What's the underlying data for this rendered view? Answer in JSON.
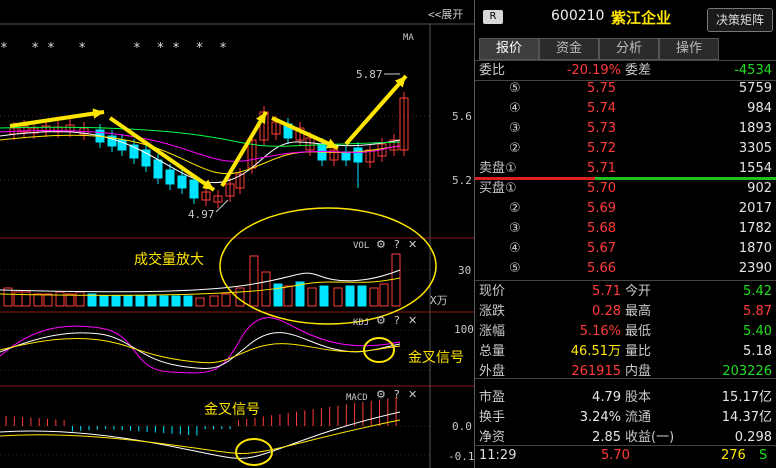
{
  "chart": {
    "expand_label": "<<展开",
    "ma_label": "MA",
    "vol_label": "VOL",
    "kdj_label": "KDJ",
    "macd_label": "MACD",
    "settings_icon": "gear-icon",
    "help_icon": "question-icon",
    "close_icon": "close-icon",
    "high_label": "5.87",
    "low_label": "4.97",
    "price_axis": [
      "5.6",
      "5.2"
    ],
    "vol_axis": [
      "30"
    ],
    "vol_unit": "X万",
    "kdj_axis": [
      "100",
      "50",
      "0"
    ],
    "macd_axis": [
      "0.0",
      "-0.1"
    ],
    "stars": "*   * *   *      *  * *  *  *",
    "annotation_volume": "成交量放大",
    "annotation_golden_cross_kdj": "金叉信号",
    "annotation_golden_cross_macd": "金叉信号"
  },
  "header": {
    "badge": "R",
    "code": "600210",
    "name": "紫江企业",
    "decision_button": "决策矩阵"
  },
  "tabs": [
    "报价",
    "资金",
    "分析",
    "操作"
  ],
  "commission": {
    "ratio_label": "委比",
    "ratio_value": "-20.19%",
    "diff_label": "委差",
    "diff_value": "-4534"
  },
  "asks": [
    {
      "level": "⑤",
      "price": "5.75",
      "volume": "5759"
    },
    {
      "level": "④",
      "price": "5.74",
      "volume": "984"
    },
    {
      "level": "③",
      "price": "5.73",
      "volume": "1893"
    },
    {
      "level": "②",
      "price": "5.72",
      "volume": "3305"
    },
    {
      "level": "卖盘①",
      "price": "5.71",
      "volume": "1554"
    }
  ],
  "bids": [
    {
      "level": "买盘①",
      "price": "5.70",
      "volume": "902"
    },
    {
      "level": "②",
      "price": "5.69",
      "volume": "2017"
    },
    {
      "level": "③",
      "price": "5.68",
      "volume": "1782"
    },
    {
      "level": "④",
      "price": "5.67",
      "volume": "1870"
    },
    {
      "level": "⑤",
      "price": "5.66",
      "volume": "2390"
    }
  ],
  "stats": [
    {
      "l1": "现价",
      "v1": "5.71",
      "c1": "red",
      "l2": "今开",
      "v2": "5.42",
      "c2": "green"
    },
    {
      "l1": "涨跌",
      "v1": "0.28",
      "c1": "red",
      "l2": "最高",
      "v2": "5.87",
      "c2": "red"
    },
    {
      "l1": "涨幅",
      "v1": "5.16%",
      "c1": "red",
      "l2": "最低",
      "v2": "5.40",
      "c2": "green"
    },
    {
      "l1": "总量",
      "v1": "46.51万",
      "c1": "yellow",
      "l2": "量比",
      "v2": "5.18",
      "c2": "white"
    },
    {
      "l1": "外盘",
      "v1": "261915",
      "c1": "red",
      "l2": "内盘",
      "v2": "203226",
      "c2": "green"
    },
    {
      "l1": "市盈",
      "v1": "4.79",
      "c1": "white",
      "l2": "股本",
      "v2": "15.17亿",
      "c2": "white"
    },
    {
      "l1": "换手",
      "v1": "3.24%",
      "c1": "white",
      "l2": "流通",
      "v2": "14.37亿",
      "c2": "white"
    },
    {
      "l1": "净资",
      "v1": "2.85",
      "c1": "white",
      "l2": "收益(一)",
      "v2": "0.298",
      "c2": "white"
    }
  ],
  "tick": {
    "time": "11:29",
    "price": "5.70",
    "volume": "276",
    "side": "S"
  },
  "colors": {
    "up": "#ff3b3b",
    "down": "#00e5ff",
    "accent": "#ffe600"
  }
}
